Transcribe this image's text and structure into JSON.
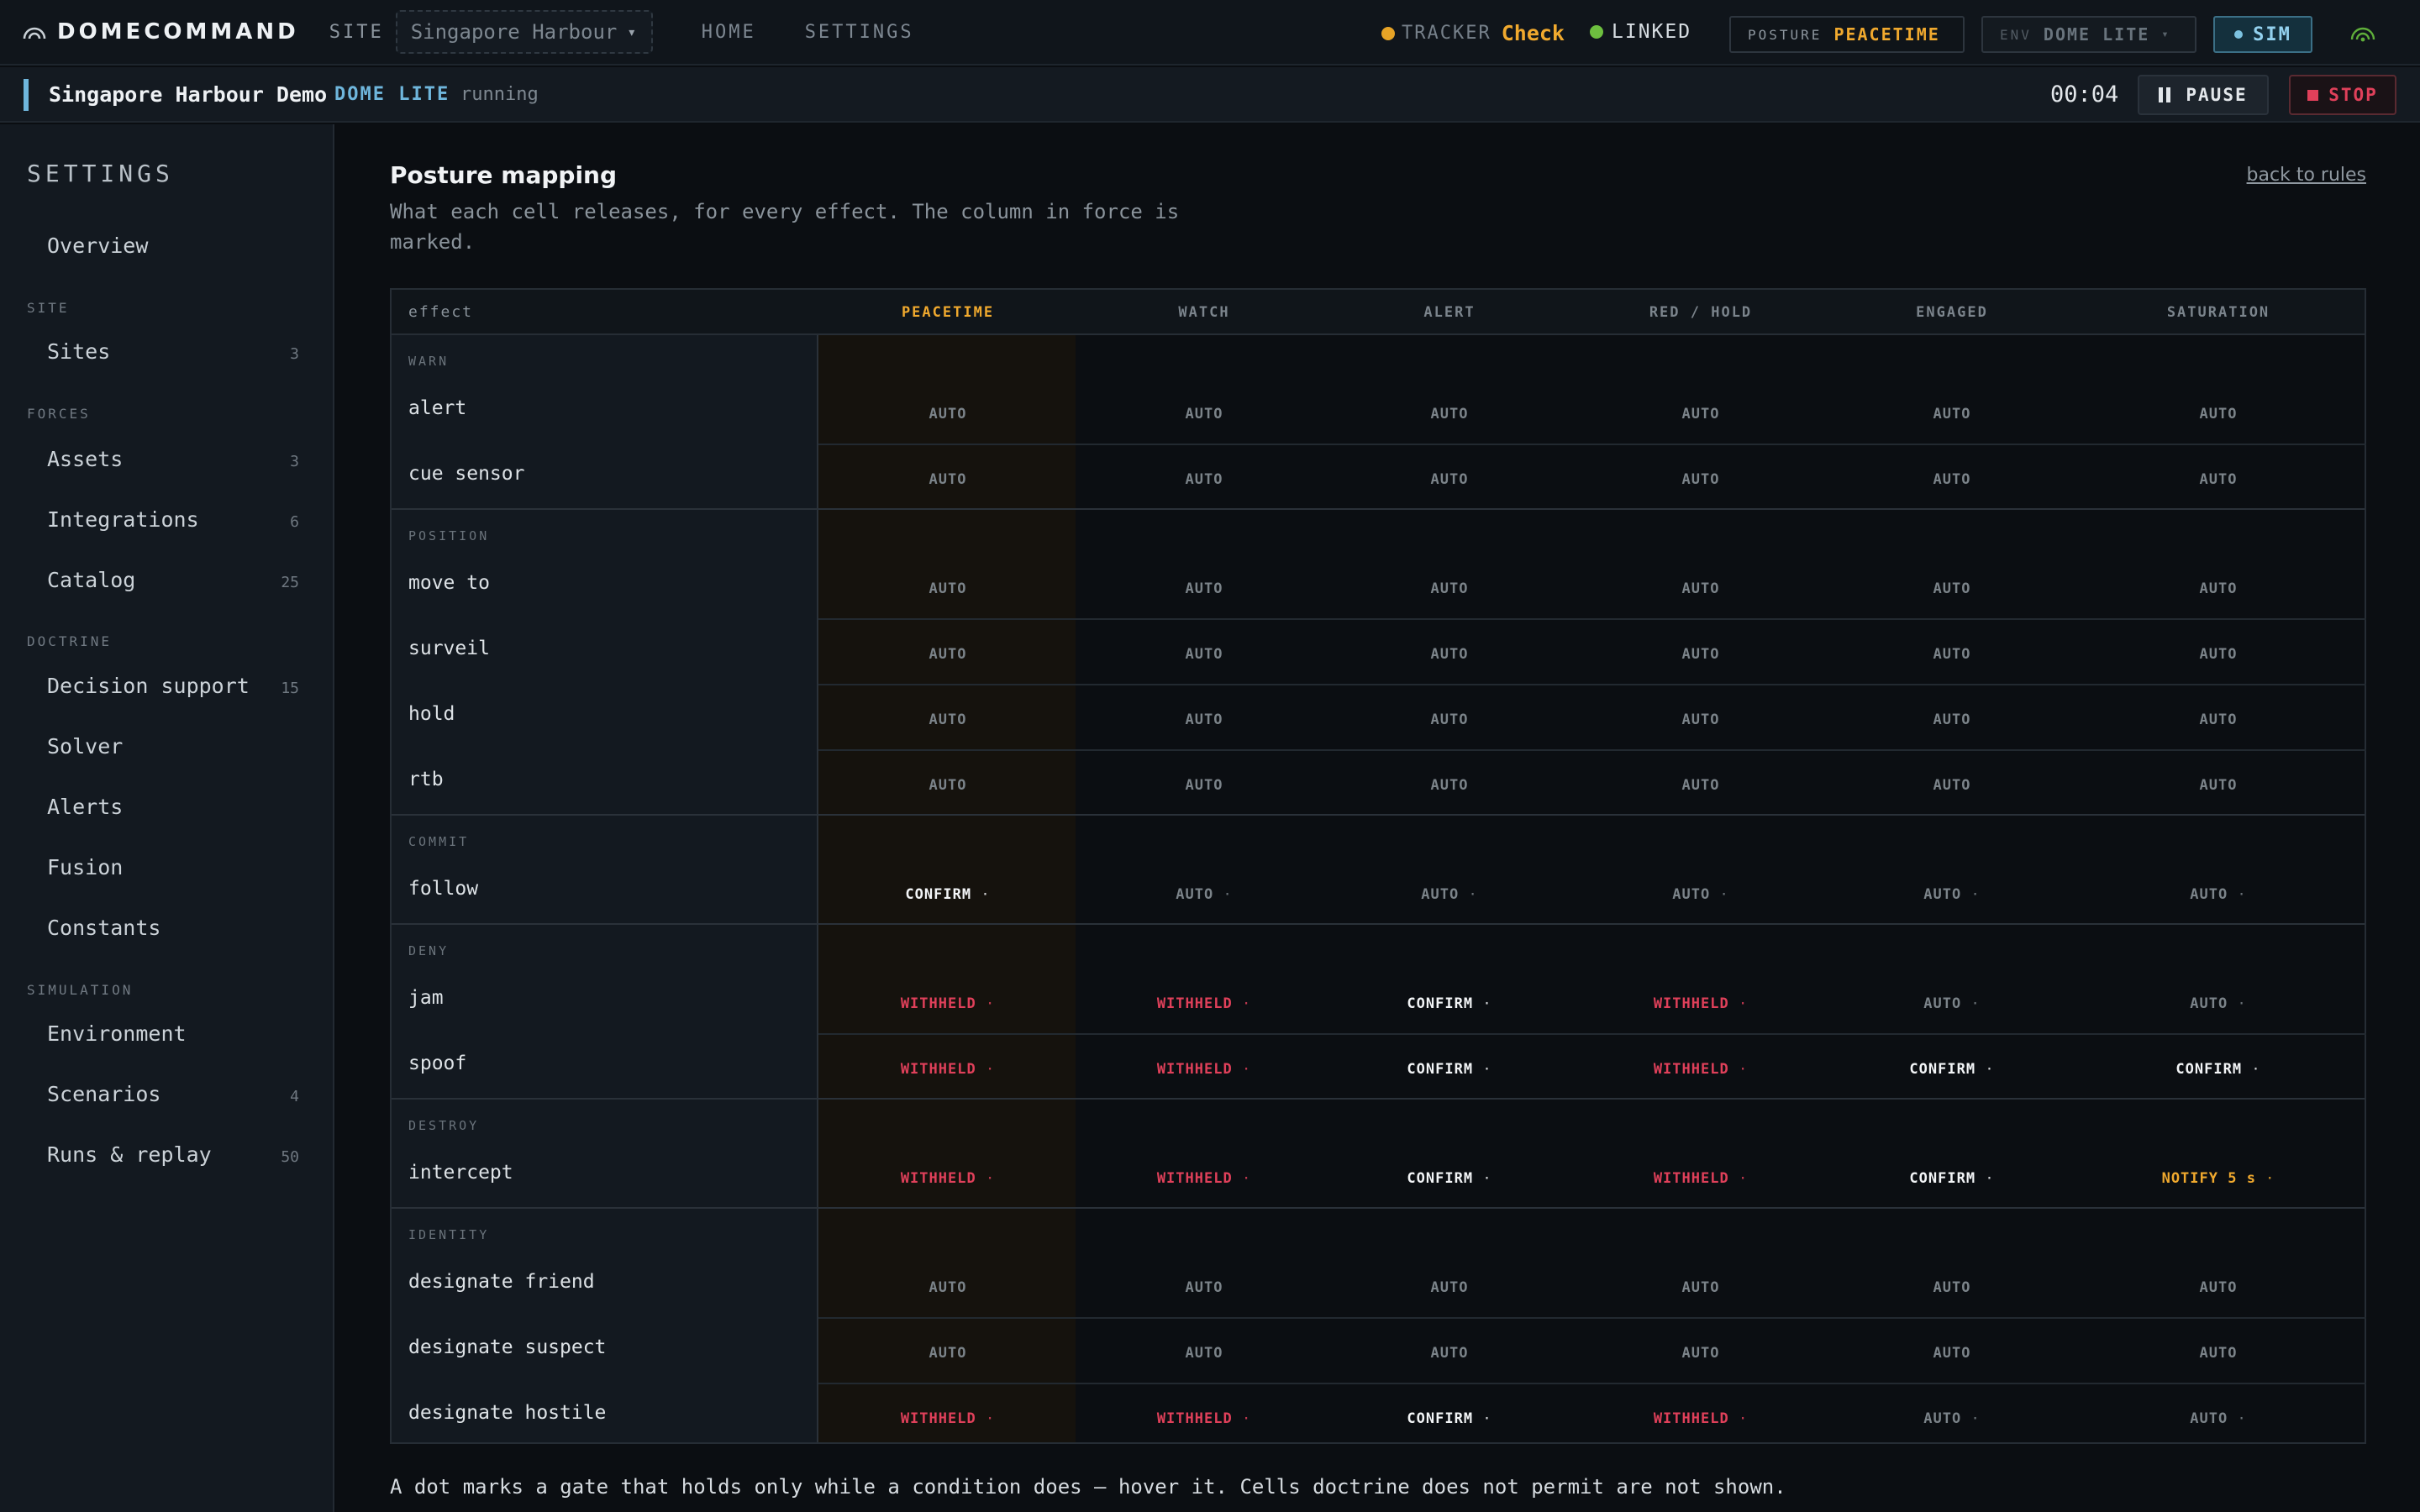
{
  "app": {
    "brand": "DOMECOMMAND"
  },
  "topbar": {
    "site_label": "SITE",
    "site_value": "Singapore Harbour",
    "nav": [
      "HOME",
      "SETTINGS"
    ],
    "tracker_label": "TRACKER",
    "tracker_value": "Check",
    "linked_label": "LINKED",
    "posture_label": "POSTURE",
    "posture_value": "PEACETIME",
    "env_label": "ENV",
    "env_value": "DOME LITE",
    "sim_label": "SIM",
    "colors": {
      "amber": "#f0a92e",
      "green": "#6dbf3f",
      "sim": "#93d1ee"
    }
  },
  "subbar": {
    "title": "Singapore Harbour Demo",
    "env": "DOME LITE",
    "state": "running",
    "timer": "00:04",
    "pause_label": "PAUSE",
    "stop_label": "STOP"
  },
  "sidebar": {
    "title": "SETTINGS",
    "overview": "Overview",
    "groups": [
      {
        "label": "SITE",
        "items": [
          {
            "label": "Sites",
            "count": "3"
          }
        ]
      },
      {
        "label": "FORCES",
        "items": [
          {
            "label": "Assets",
            "count": "3"
          },
          {
            "label": "Integrations",
            "count": "6"
          },
          {
            "label": "Catalog",
            "count": "25"
          }
        ]
      },
      {
        "label": "DOCTRINE",
        "items": [
          {
            "label": "Decision support",
            "count": "15"
          },
          {
            "label": "Solver",
            "count": ""
          },
          {
            "label": "Alerts",
            "count": ""
          },
          {
            "label": "Fusion",
            "count": ""
          },
          {
            "label": "Constants",
            "count": ""
          }
        ]
      },
      {
        "label": "SIMULATION",
        "items": [
          {
            "label": "Environment",
            "count": ""
          },
          {
            "label": "Scenarios",
            "count": "4"
          },
          {
            "label": "Runs & replay",
            "count": "50"
          }
        ]
      }
    ]
  },
  "main": {
    "title": "Posture mapping",
    "description": "What each cell releases, for every effect. The column in force is marked.",
    "back_link": "back to rules",
    "footnote": "A dot marks a gate that holds only while a condition does — hover it. Cells doctrine does not permit are not shown.",
    "table": {
      "effect_header": "effect",
      "columns": [
        "PEACETIME",
        "WATCH",
        "ALERT",
        "RED / HOLD",
        "ENGAGED",
        "SATURATION"
      ],
      "active_column": 0,
      "groups": [
        {
          "label": "WARN",
          "rows": [
            {
              "name": "alert",
              "cells": [
                "AUTO",
                "AUTO",
                "AUTO",
                "AUTO",
                "AUTO",
                "AUTO"
              ],
              "gated": [
                false,
                false,
                false,
                false,
                false,
                false
              ]
            },
            {
              "name": "cue sensor",
              "cells": [
                "AUTO",
                "AUTO",
                "AUTO",
                "AUTO",
                "AUTO",
                "AUTO"
              ],
              "gated": [
                false,
                false,
                false,
                false,
                false,
                false
              ]
            }
          ]
        },
        {
          "label": "POSITION",
          "rows": [
            {
              "name": "move to",
              "cells": [
                "AUTO",
                "AUTO",
                "AUTO",
                "AUTO",
                "AUTO",
                "AUTO"
              ],
              "gated": [
                false,
                false,
                false,
                false,
                false,
                false
              ]
            },
            {
              "name": "surveil",
              "cells": [
                "AUTO",
                "AUTO",
                "AUTO",
                "AUTO",
                "AUTO",
                "AUTO"
              ],
              "gated": [
                false,
                false,
                false,
                false,
                false,
                false
              ]
            },
            {
              "name": "hold",
              "cells": [
                "AUTO",
                "AUTO",
                "AUTO",
                "AUTO",
                "AUTO",
                "AUTO"
              ],
              "gated": [
                false,
                false,
                false,
                false,
                false,
                false
              ]
            },
            {
              "name": "rtb",
              "cells": [
                "AUTO",
                "AUTO",
                "AUTO",
                "AUTO",
                "AUTO",
                "AUTO"
              ],
              "gated": [
                false,
                false,
                false,
                false,
                false,
                false
              ]
            }
          ]
        },
        {
          "label": "COMMIT",
          "rows": [
            {
              "name": "follow",
              "cells": [
                "CONFIRM",
                "AUTO",
                "AUTO",
                "AUTO",
                "AUTO",
                "AUTO"
              ],
              "gated": [
                true,
                true,
                true,
                true,
                true,
                true
              ]
            }
          ]
        },
        {
          "label": "DENY",
          "rows": [
            {
              "name": "jam",
              "cells": [
                "WITHHELD",
                "WITHHELD",
                "CONFIRM",
                "WITHHELD",
                "AUTO",
                "AUTO"
              ],
              "gated": [
                true,
                true,
                true,
                true,
                true,
                true
              ]
            },
            {
              "name": "spoof",
              "cells": [
                "WITHHELD",
                "WITHHELD",
                "CONFIRM",
                "WITHHELD",
                "CONFIRM",
                "CONFIRM"
              ],
              "gated": [
                true,
                true,
                true,
                true,
                true,
                true
              ]
            }
          ]
        },
        {
          "label": "DESTROY",
          "rows": [
            {
              "name": "intercept",
              "cells": [
                "WITHHELD",
                "WITHHELD",
                "CONFIRM",
                "WITHHELD",
                "CONFIRM",
                "NOTIFY 5 s"
              ],
              "gated": [
                true,
                true,
                true,
                true,
                true,
                true
              ]
            }
          ]
        },
        {
          "label": "IDENTITY",
          "rows": [
            {
              "name": "designate friend",
              "cells": [
                "AUTO",
                "AUTO",
                "AUTO",
                "AUTO",
                "AUTO",
                "AUTO"
              ],
              "gated": [
                false,
                false,
                false,
                false,
                false,
                false
              ]
            },
            {
              "name": "designate suspect",
              "cells": [
                "AUTO",
                "AUTO",
                "AUTO",
                "AUTO",
                "AUTO",
                "AUTO"
              ],
              "gated": [
                false,
                false,
                false,
                false,
                false,
                false
              ]
            },
            {
              "name": "designate hostile",
              "cells": [
                "WITHHELD",
                "WITHHELD",
                "CONFIRM",
                "WITHHELD",
                "AUTO",
                "AUTO"
              ],
              "gated": [
                true,
                true,
                true,
                true,
                true,
                true
              ]
            }
          ]
        }
      ]
    }
  }
}
